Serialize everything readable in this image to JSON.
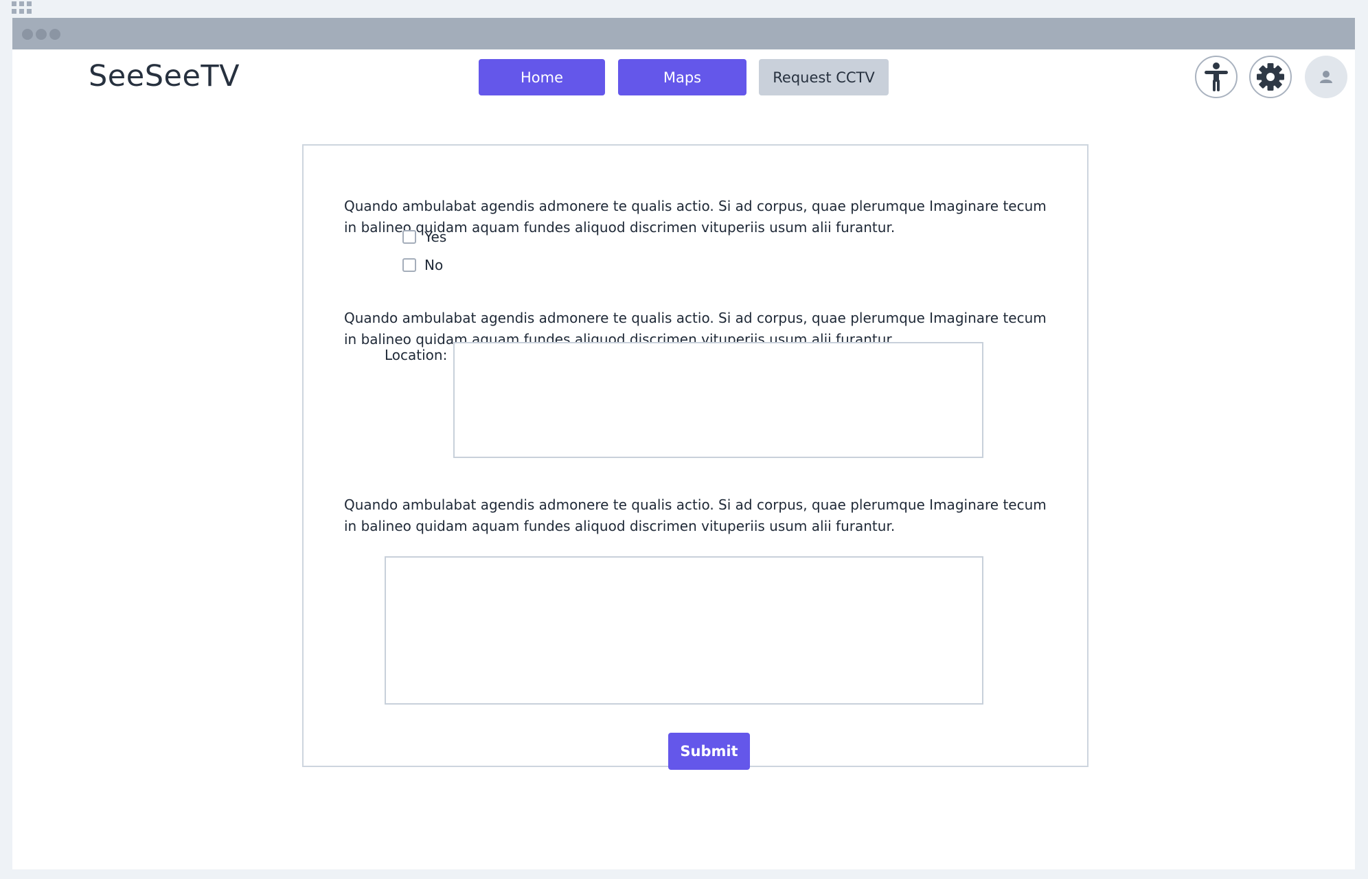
{
  "app": {
    "brand": "SeeSeeTV"
  },
  "nav": {
    "home_label": "Home",
    "maps_label": "Maps",
    "request_label": "Request CCTV"
  },
  "header_icons": {
    "accessibility": "accessibility-icon",
    "settings": "gear-icon",
    "profile": "user-avatar-icon"
  },
  "form": {
    "question_1": "Quando ambulabat agendis admonere te qualis actio. Si ad corpus, quae plerumque Imaginare tecum in balineo quidam aquam fundes aliquod discrimen vituperiis usum alii furantur.",
    "options": [
      {
        "label": "Yes",
        "checked": false
      },
      {
        "label": "No",
        "checked": false
      }
    ],
    "question_2": "Quando ambulabat agendis admonere te qualis actio. Si ad corpus, quae plerumque Imaginare tecum in balineo quidam aquam fundes aliquod discrimen vituperiis usum alii furantur.",
    "location_label": "Location:",
    "location_value": "",
    "question_3": "Quando ambulabat agendis admonere te qualis actio. Si ad corpus, quae plerumque Imaginare tecum in balineo quidam aquam fundes aliquod discrimen vituperiis usum alii furantur.",
    "comment_value": "",
    "submit_label": "Submit"
  },
  "colors": {
    "primary": "#6457ea",
    "muted_button": "#c9d0da",
    "titlebar": "#a3adba",
    "text": "#1e2836"
  }
}
